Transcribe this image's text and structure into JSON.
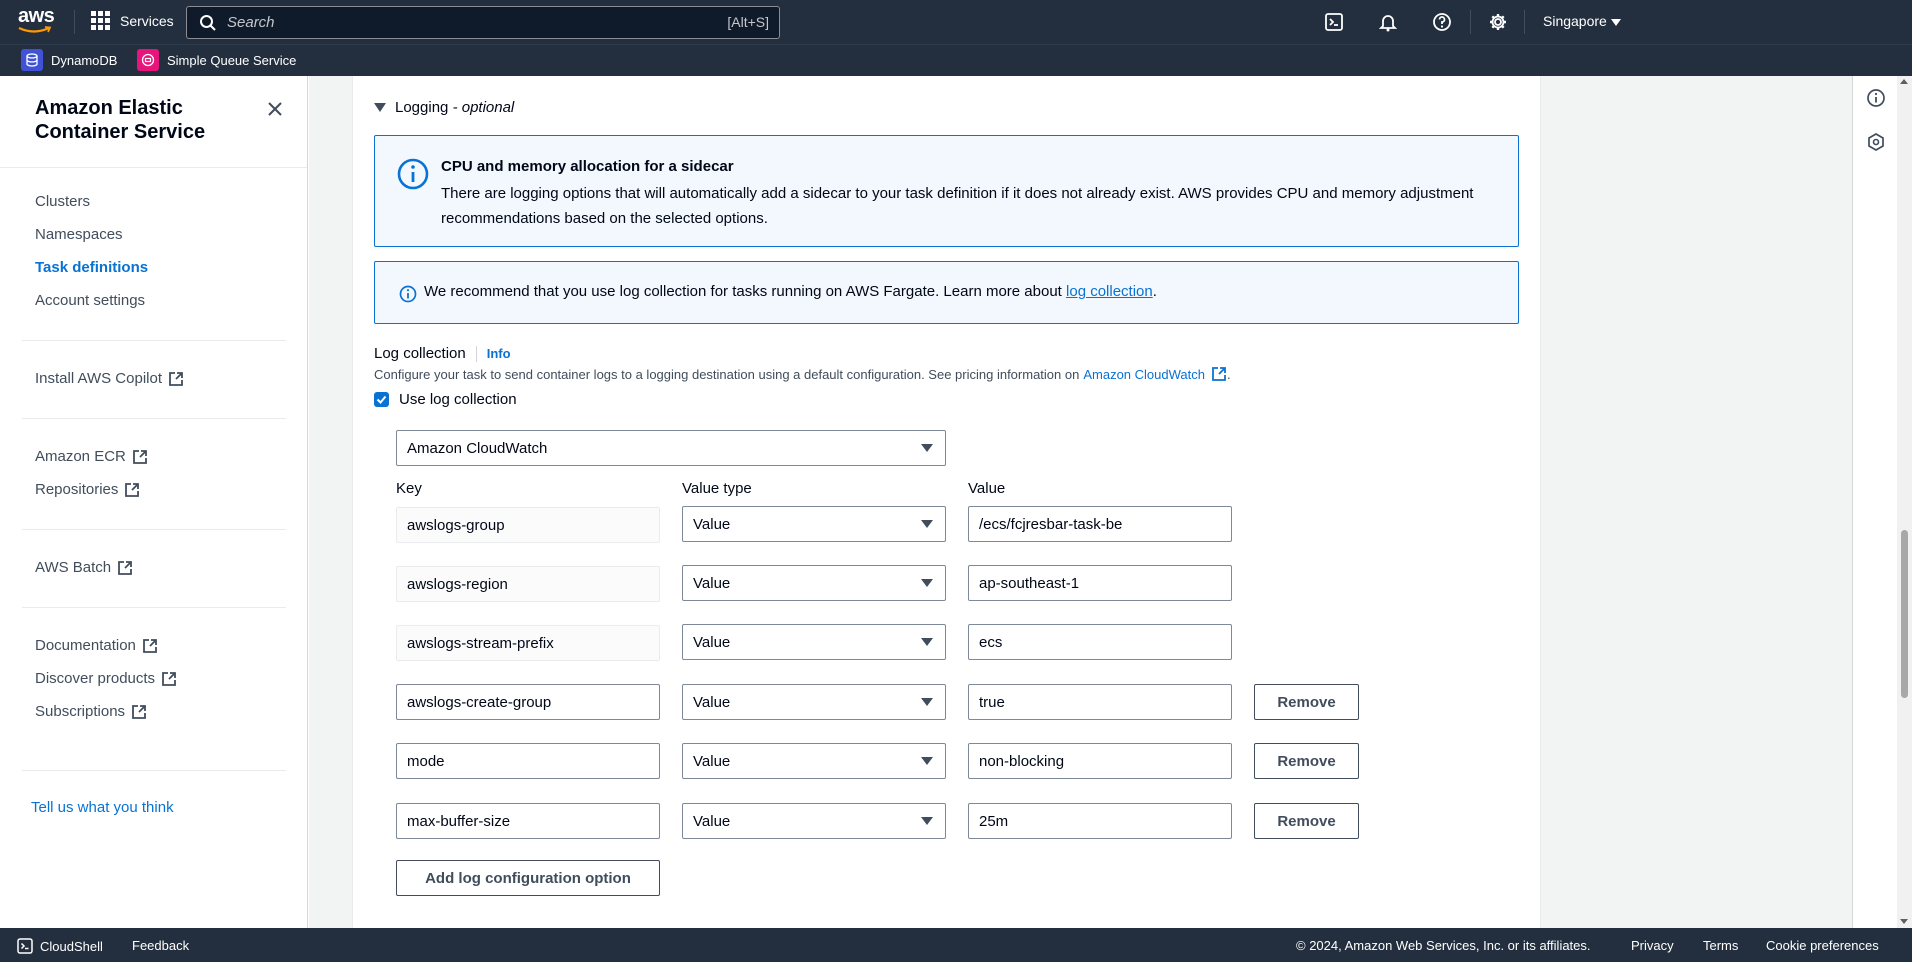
{
  "topnav": {
    "logo_text": "aws",
    "services_label": "Services",
    "search_placeholder": "Search",
    "search_shortcut": "[Alt+S]",
    "region": "Singapore"
  },
  "favorites": [
    {
      "label": "DynamoDB",
      "color": "#4053d6"
    },
    {
      "label": "Simple Queue Service",
      "color": "#e7157b"
    }
  ],
  "sidenav": {
    "title": "Amazon Elastic Container Service",
    "items": [
      {
        "label": "Clusters"
      },
      {
        "label": "Namespaces"
      },
      {
        "label": "Task definitions"
      },
      {
        "label": "Account settings"
      },
      {
        "label": "Install AWS Copilot"
      },
      {
        "label": "Amazon ECR"
      },
      {
        "label": "Repositories"
      },
      {
        "label": "AWS Batch"
      },
      {
        "label": "Documentation"
      },
      {
        "label": "Discover products"
      },
      {
        "label": "Subscriptions"
      }
    ],
    "feedback": "Tell us what you think"
  },
  "logging": {
    "section_title": "Logging",
    "section_optional": "- optional",
    "sidecar_alert": {
      "title": "CPU and memory allocation for a sidecar",
      "body": "There are logging options that will automatically add a sidecar to your task definition if it does not already exist. AWS provides CPU and memory adjustment recommendations based on the selected options."
    },
    "recommend_alert": {
      "text": "We recommend that you use log collection for tasks running on AWS Fargate. Learn more about",
      "link": "log collection",
      "suffix": "."
    },
    "log_collection_label": "Log collection",
    "info_label": "Info",
    "description": "Configure your task to send container logs to a logging destination using a default configuration. See pricing information on",
    "description_link": "Amazon CloudWatch",
    "description_suffix": ".",
    "use_log_collection_label": "Use log collection",
    "use_log_collection_checked": true,
    "destination": "Amazon CloudWatch",
    "columns": {
      "key": "Key",
      "value_type": "Value type",
      "value": "Value"
    },
    "options": [
      {
        "key": "awslogs-group",
        "value_type": "Value",
        "value": "/ecs/fcjresbar-task-be",
        "removable": false
      },
      {
        "key": "awslogs-region",
        "value_type": "Value",
        "value": "ap-southeast-1",
        "removable": false
      },
      {
        "key": "awslogs-stream-prefix",
        "value_type": "Value",
        "value": "ecs",
        "removable": false
      },
      {
        "key": "awslogs-create-group",
        "value_type": "Value",
        "value": "true",
        "removable": true
      },
      {
        "key": "mode",
        "value_type": "Value",
        "value": "non-blocking",
        "removable": true
      },
      {
        "key": "max-buffer-size",
        "value_type": "Value",
        "value": "25m",
        "removable": true
      }
    ],
    "remove_label": "Remove",
    "add_option_label": "Add log configuration option"
  },
  "footer": {
    "cloudshell": "CloudShell",
    "feedback": "Feedback",
    "copyright": "© 2024, Amazon Web Services, Inc. or its affiliates.",
    "privacy": "Privacy",
    "terms": "Terms",
    "cookies": "Cookie preferences"
  },
  "colors": {
    "nav_bg": "#232f3e",
    "link": "#0972d3",
    "alert_bg": "#f2f8fd"
  }
}
